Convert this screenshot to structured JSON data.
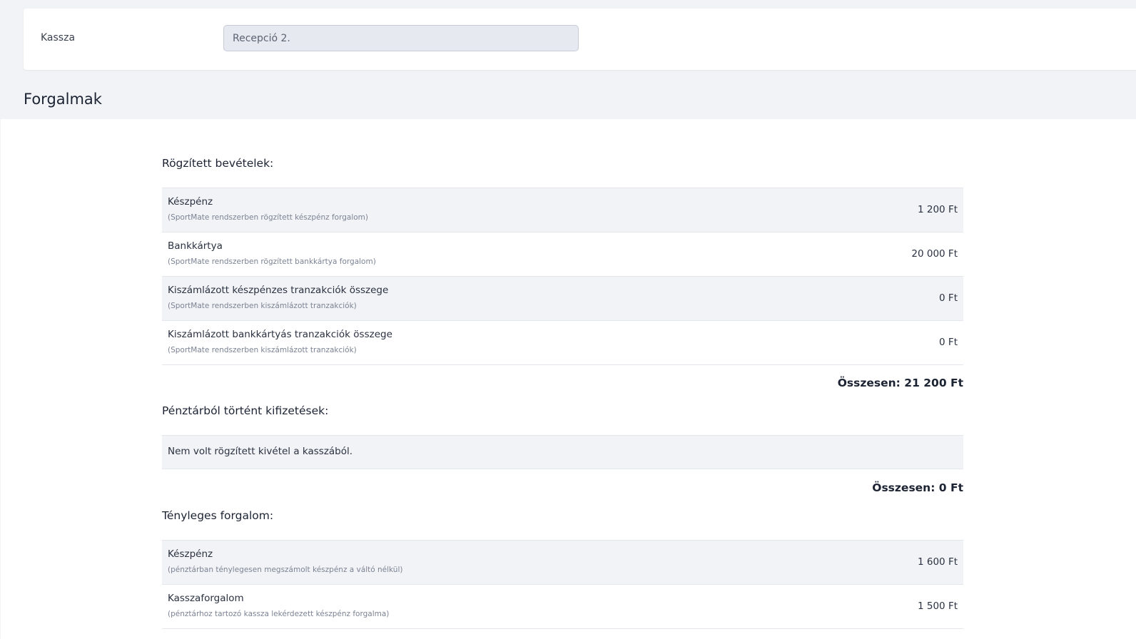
{
  "header": {
    "kassza_label": "Kassza",
    "kassza_value": "Recepció 2."
  },
  "section_title": "Forgalmak",
  "recorded_income": {
    "heading": "Rögzített bevételek:",
    "rows": [
      {
        "title": "Készpénz",
        "subtitle": "(SportMate rendszerben rögzített készpénz forgalom)",
        "amount": "1 200 Ft"
      },
      {
        "title": "Bankkártya",
        "subtitle": "(SportMate rendszerben rögzített bankkártya forgalom)",
        "amount": "20 000 Ft"
      },
      {
        "title": "Kiszámlázott készpénzes tranzakciók összege",
        "subtitle": "(SportMate rendszerben kiszámlázott tranzakciók)",
        "amount": "0 Ft"
      },
      {
        "title": "Kiszámlázott bankkártyás tranzakciók összege",
        "subtitle": "(SportMate rendszerben kiszámlázott tranzakciók)",
        "amount": "0 Ft"
      }
    ],
    "total": "Összesen: 21 200 Ft"
  },
  "payouts": {
    "heading": "Pénztárból történt kifizetések:",
    "empty_message": "Nem volt rögzített kivétel a kasszából.",
    "total": "Összesen: 0 Ft"
  },
  "actual_turnover": {
    "heading": "Tényleges forgalom:",
    "rows": [
      {
        "title": "Készpénz",
        "subtitle": "(pénztárban ténylegesen megszámolt készpénz a váltó nélkül)",
        "amount": "1 600 Ft"
      },
      {
        "title": "Kasszaforgalom",
        "subtitle": "(pénztárhoz tartozó kassza lekérdezett készpénz forgalma)",
        "amount": "1 500 Ft"
      }
    ]
  }
}
